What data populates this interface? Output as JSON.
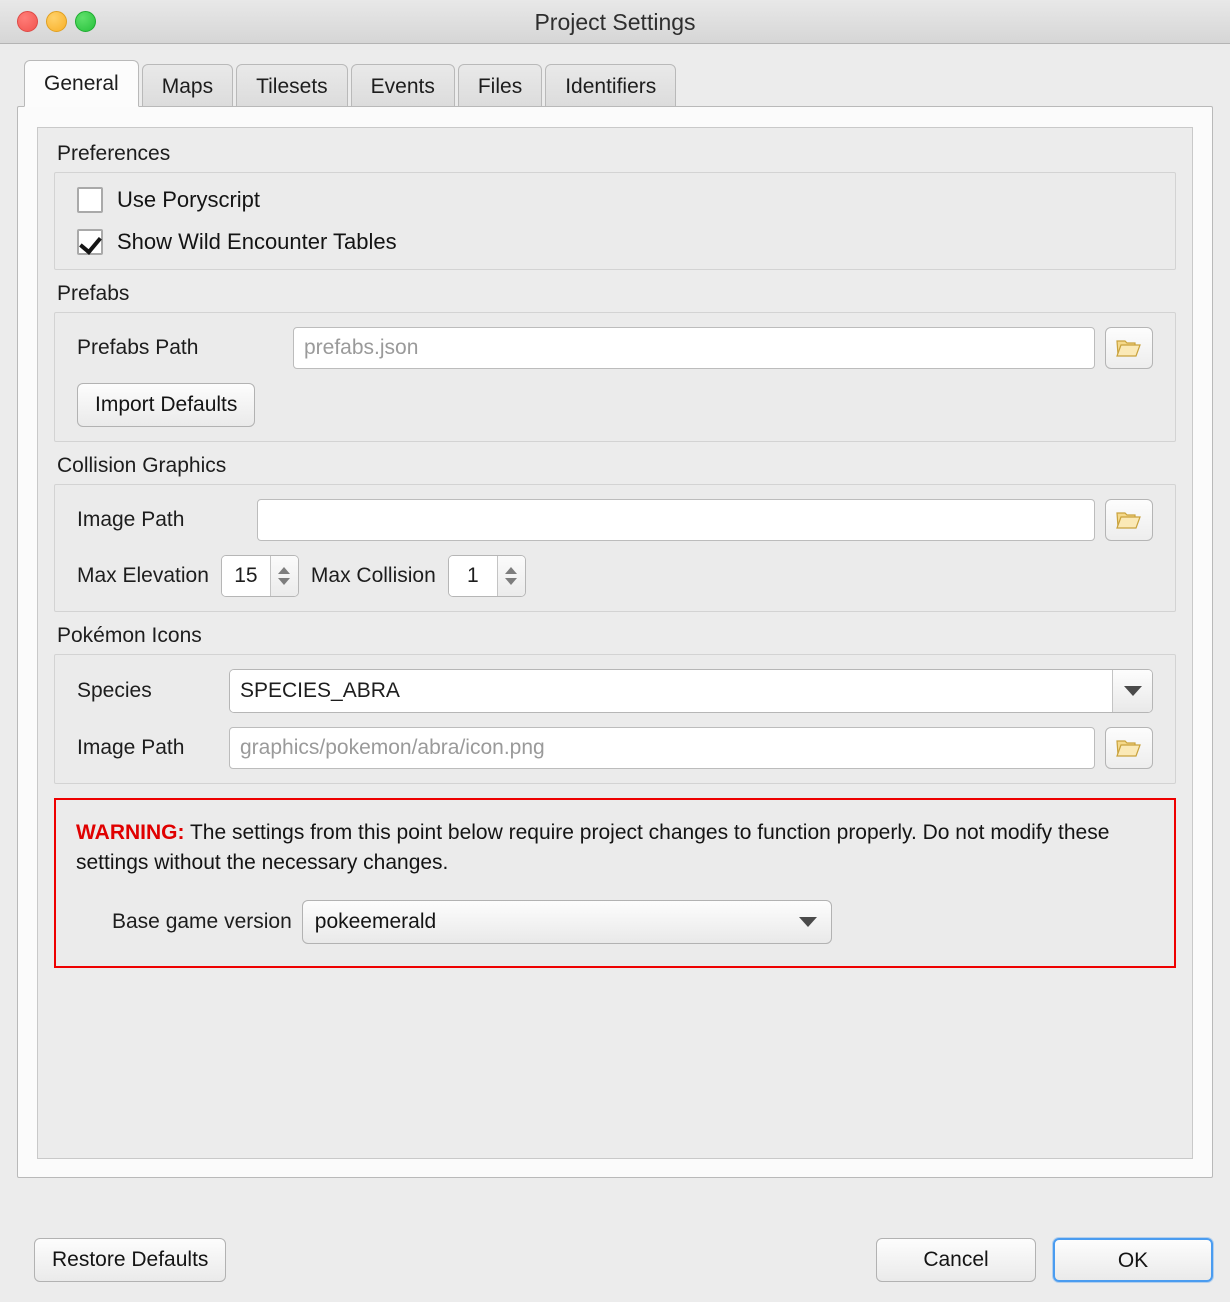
{
  "window": {
    "title": "Project Settings",
    "traffic_lights": [
      {
        "name": "close",
        "color": "#f1544f"
      },
      {
        "name": "minimize",
        "color": "#f8b029"
      },
      {
        "name": "maximize",
        "color": "#28c13c"
      }
    ]
  },
  "tabs": [
    {
      "label": "General",
      "active": true
    },
    {
      "label": "Maps",
      "active": false
    },
    {
      "label": "Tilesets",
      "active": false
    },
    {
      "label": "Events",
      "active": false
    },
    {
      "label": "Files",
      "active": false
    },
    {
      "label": "Identifiers",
      "active": false
    }
  ],
  "preferences": {
    "group_title": "Preferences",
    "use_poryscript": {
      "label": "Use Poryscript",
      "checked": false
    },
    "show_wild_encounter_tables": {
      "label": "Show Wild Encounter Tables",
      "checked": true
    }
  },
  "prefabs": {
    "group_title": "Prefabs",
    "path_label": "Prefabs Path",
    "path_value": "",
    "path_placeholder": "prefabs.json",
    "browse_icon": "folder-open-icon",
    "import_defaults_label": "Import Defaults"
  },
  "collision_graphics": {
    "group_title": "Collision Graphics",
    "image_path_label": "Image Path",
    "image_path_value": "",
    "image_path_placeholder": "",
    "browse_icon": "folder-open-icon",
    "max_elevation_label": "Max Elevation",
    "max_elevation_value": "15",
    "max_collision_label": "Max Collision",
    "max_collision_value": "1"
  },
  "pokemon_icons": {
    "group_title": "Pokémon Icons",
    "species_label": "Species",
    "species_value": "SPECIES_ABRA",
    "species_dropdown_icon": "chevron-down-icon",
    "image_path_label": "Image Path",
    "image_path_value": "",
    "image_path_placeholder": "graphics/pokemon/abra/icon.png",
    "browse_icon": "folder-open-icon"
  },
  "warning": {
    "keyword": "WARNING:",
    "text": " The settings from this point below require project changes to function properly. Do not modify these settings without the necessary changes.",
    "border_color": "#ee0000",
    "keyword_color": "#e00000",
    "base_game_version_label": "Base game version",
    "base_game_version_value": "pokeemerald",
    "base_game_version_dropdown_icon": "chevron-down-icon"
  },
  "footer": {
    "restore_defaults_label": "Restore Defaults",
    "cancel_label": "Cancel",
    "ok_label": "OK",
    "ok_focus_color": "#4a9cf0"
  }
}
